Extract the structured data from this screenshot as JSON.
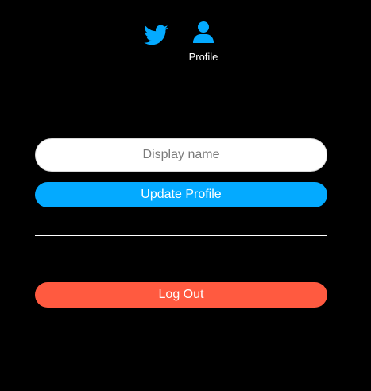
{
  "nav": {
    "home_icon": "twitter-bird-icon",
    "profile_icon": "user-icon",
    "profile_label": "Profile"
  },
  "profile_form": {
    "display_name_placeholder": "Display name",
    "display_name_value": "",
    "update_label": "Update Profile"
  },
  "logout_label": "Log Out",
  "colors": {
    "background": "#000000",
    "accent_blue": "#04aaff",
    "logout_red": "#ff5a40",
    "input_background": "#ffffff",
    "text_white": "#ffffff"
  }
}
